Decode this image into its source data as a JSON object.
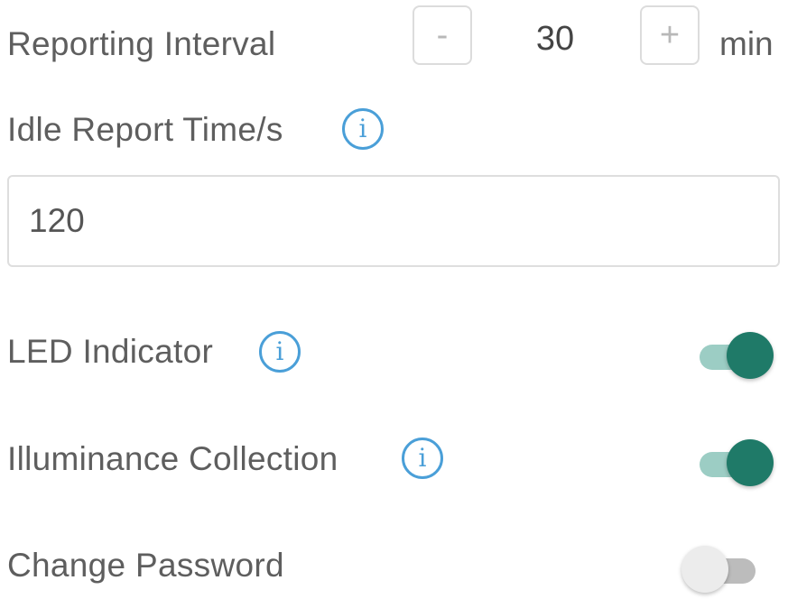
{
  "reporting_interval": {
    "label": "Reporting Interval",
    "decrement_label": "-",
    "value": "30",
    "increment_label": "+",
    "unit": "min"
  },
  "idle_report": {
    "label": "Idle Report Time/s",
    "info_icon": "i",
    "value": "120"
  },
  "led_indicator": {
    "label": "LED Indicator",
    "info_icon": "i",
    "enabled": true
  },
  "illuminance_collection": {
    "label": "Illuminance Collection",
    "info_icon": "i",
    "enabled": true
  },
  "change_password": {
    "label": "Change Password",
    "enabled": false
  },
  "colors": {
    "accent": "#1f7a68",
    "accent_track": "#9ccdc4",
    "info": "#4a9fd8",
    "text": "#5e5e5e"
  },
  "icons": {
    "info": "info-circle-icon"
  }
}
